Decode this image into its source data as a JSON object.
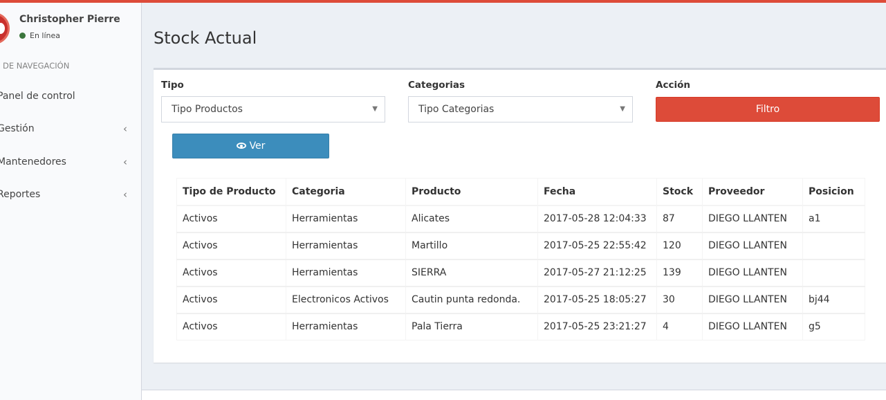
{
  "user": {
    "name": "Christopher Pierre",
    "status": "En línea"
  },
  "nav": {
    "header": "DE NAVEGACIÓN",
    "items": [
      {
        "label": "Panel de control",
        "chevron": ""
      },
      {
        "label": "Gestión",
        "chevron": "‹"
      },
      {
        "label": "Mantenedores",
        "chevron": "‹"
      },
      {
        "label": "Reportes",
        "chevron": "‹"
      }
    ]
  },
  "page": {
    "title": "Stock Actual"
  },
  "filters": {
    "tipo": {
      "label": "Tipo",
      "value": "Tipo Productos"
    },
    "categorias": {
      "label": "Categorias",
      "value": "Tipo Categorias"
    },
    "accion": {
      "label": "Acción",
      "button": "Filtro"
    }
  },
  "ver_button": "Ver",
  "table": {
    "headers": [
      "Tipo de Producto",
      "Categoria",
      "Producto",
      "Fecha",
      "Stock",
      "Proveedor",
      "Posicion"
    ],
    "rows": [
      [
        "Activos",
        "Herramientas",
        "Alicates",
        "2017-05-28 12:04:33",
        "87",
        "DIEGO LLANTEN",
        "a1"
      ],
      [
        "Activos",
        "Herramientas",
        "Martillo",
        "2017-05-25 22:55:42",
        "120",
        "DIEGO LLANTEN",
        ""
      ],
      [
        "Activos",
        "Herramientas",
        "SIERRA",
        "2017-05-27 21:12:25",
        "139",
        "DIEGO LLANTEN",
        ""
      ],
      [
        "Activos",
        "Electronicos Activos",
        "Cautin punta redonda.",
        "2017-05-25 18:05:27",
        "30",
        "DIEGO LLANTEN",
        "bj44"
      ],
      [
        "Activos",
        "Herramientas",
        "Pala Tierra",
        "2017-05-25 23:21:27",
        "4",
        "DIEGO LLANTEN",
        "g5"
      ]
    ]
  },
  "colors": {
    "accent": "#dd4b39",
    "primary": "#3c8dbc",
    "status_online": "#3c763d"
  }
}
